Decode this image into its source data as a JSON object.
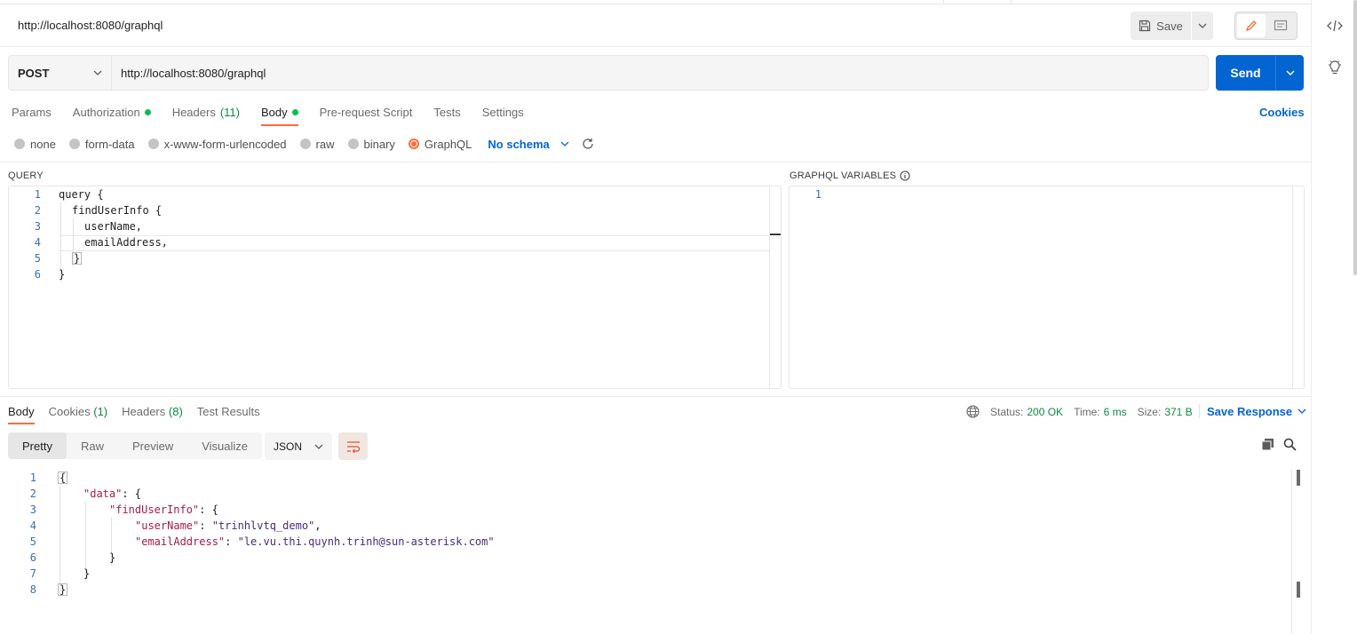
{
  "request": {
    "title": "http://localhost:8080/graphql",
    "save_label": "Save",
    "method": "POST",
    "url": "http://localhost:8080/graphql",
    "send_label": "Send"
  },
  "tabs": {
    "params": "Params",
    "authorization": "Authorization",
    "headers": "Headers",
    "headers_count": "(11)",
    "body": "Body",
    "pre_request": "Pre-request Script",
    "tests": "Tests",
    "settings": "Settings",
    "cookies": "Cookies"
  },
  "body_types": {
    "none": "none",
    "form_data": "form-data",
    "urlencoded": "x-www-form-urlencoded",
    "raw": "raw",
    "binary": "binary",
    "graphql": "GraphQL",
    "selected": "GraphQL",
    "schema": "No schema"
  },
  "query_panel": {
    "label": "QUERY",
    "lines": [
      {
        "n": "1",
        "text": "query {"
      },
      {
        "n": "2",
        "text": "findUserInfo {"
      },
      {
        "n": "3",
        "text": "userName,"
      },
      {
        "n": "4",
        "text": "emailAddress,"
      },
      {
        "n": "5",
        "text": "}"
      },
      {
        "n": "6",
        "text": "}"
      }
    ]
  },
  "variables_panel": {
    "label": "GRAPHQL VARIABLES",
    "lines": [
      {
        "n": "1",
        "text": ""
      }
    ]
  },
  "response": {
    "tabs": {
      "body": "Body",
      "cookies": "Cookies",
      "cookies_count": "(1)",
      "headers": "Headers",
      "headers_count": "(8)",
      "test_results": "Test Results"
    },
    "status_label": "Status:",
    "status_value": "200 OK",
    "time_label": "Time:",
    "time_value": "6 ms",
    "size_label": "Size:",
    "size_value": "371 B",
    "save_response": "Save Response",
    "view_modes": {
      "pretty": "Pretty",
      "raw": "Raw",
      "preview": "Preview",
      "visualize": "Visualize"
    },
    "format": "JSON",
    "lines": [
      {
        "n": "1",
        "text": "{"
      },
      {
        "n": "2",
        "key": "\"data\"",
        "rest": ": {"
      },
      {
        "n": "3",
        "key": "\"findUserInfo\"",
        "rest": ": {"
      },
      {
        "n": "4",
        "key": "\"userName\"",
        "rest": ": ",
        "val": "\"trinhlvtq_demo\"",
        "tail": ","
      },
      {
        "n": "5",
        "key": "\"emailAddress\"",
        "rest": ": ",
        "val": "\"le.vu.thi.quynh.trinh@sun-asterisk.com\"",
        "tail": ""
      },
      {
        "n": "6",
        "text": "}"
      },
      {
        "n": "7",
        "text": "}"
      },
      {
        "n": "8",
        "text": "}"
      }
    ]
  },
  "colors": {
    "accent": "#ff6c37",
    "send_button": "#0265d2",
    "status_ok": "#0c8a3f",
    "indicator_dot": "#0cbb52"
  },
  "icons": {
    "save": "floppy-disk-icon",
    "edit_mode": "pencil-icon",
    "comment_mode": "comment-icon",
    "code": "code-icon",
    "bulb": "lightbulb-icon",
    "refresh": "refresh-icon",
    "info": "info-icon",
    "globe": "globe-icon",
    "wrap": "wrap-lines-icon",
    "copy": "copy-icon",
    "search": "search-icon"
  }
}
